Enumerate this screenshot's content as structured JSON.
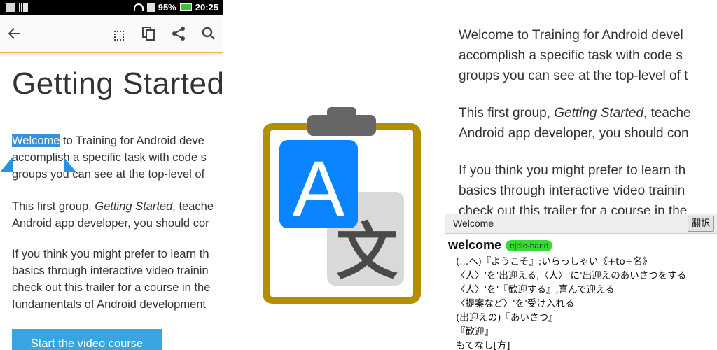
{
  "status_bar": {
    "battery": "95%",
    "time": "20:25"
  },
  "colors": {
    "accent_blue": "#37a6e0",
    "highlight_blue": "#3a8fd9",
    "toolbar_underline": "#f2b64a",
    "logo_frame": "#b38f00",
    "logo_a_bg": "#0a84ff",
    "badge_green": "#33dd33"
  },
  "toolbar": {
    "back_icon": "arrow-left-icon",
    "icons": [
      "select-all-icon",
      "copy-icon",
      "share-icon",
      "search-icon"
    ]
  },
  "left": {
    "title": "Getting Started",
    "p1": {
      "selected_word": "Welcome",
      "line1_rest": " to Training for Android deve",
      "line2": "accomplish a specific task with code s",
      "line3": "groups you can see at the top-level of"
    },
    "p2": {
      "line1_before": "This first group, ",
      "line1_italic": "Getting Started",
      "line1_after": ", teache",
      "line2": "Android app developer, you should cor"
    },
    "p3": {
      "line1": "If you think you might prefer to learn th",
      "line2": "basics through interactive video trainin",
      "line3": "check out this trailer for a course in the",
      "line4": "fundamentals of Android development"
    },
    "video_button": "Start the video course"
  },
  "logo": {
    "letter_a": "A",
    "letter_kanji": "文"
  },
  "right": {
    "p1": {
      "line1": "Welcome to Training for Android devel",
      "line2": "accomplish a specific task with code s",
      "line3": "groups you can see at the top-level of t"
    },
    "p2": {
      "line1_before": "This first group, ",
      "line1_italic": "Getting Started",
      "line1_after": ", teache",
      "line2": "Android app developer, you should con"
    },
    "p3": {
      "line1": "If you think you might prefer to learn th",
      "line2": "basics through interactive video trainin",
      "line3": "check out this trailer for a course in the"
    },
    "popup": {
      "header_word": "Welcome",
      "translate_button": "翻訳",
      "entry_word": "welcome",
      "dict_badge": "ejdic-hand",
      "definitions": [
        "(...へ)『ようこそ』;いらっしゃい《+to+名》",
        "〈人〉'を'出迎える,〈人〉'に'出迎えのあいさつをする",
        "〈人〉'を'『歓迎する』,喜んで迎える",
        "〈提案など〉'を'受け入れる",
        "(出迎えの)『あいさつ』",
        "『歓迎』",
        "もてなし[方]"
      ]
    }
  }
}
